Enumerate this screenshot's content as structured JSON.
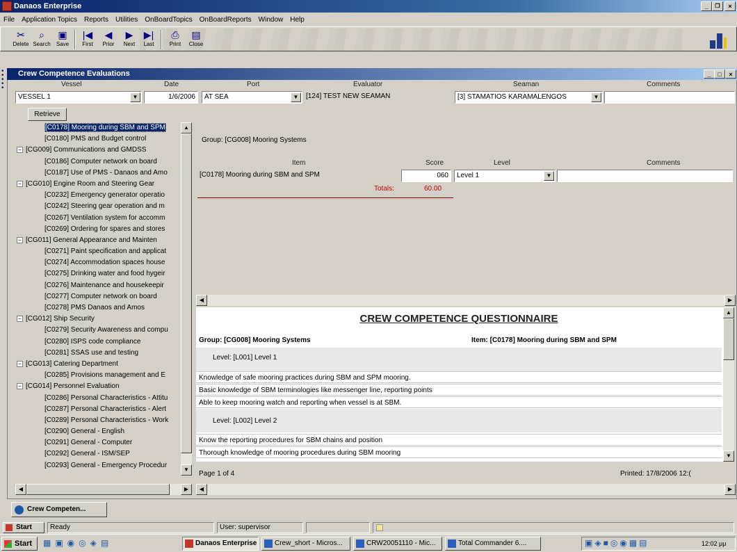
{
  "app": {
    "title": "Danaos Enterprise",
    "menu": [
      "File",
      "Application Topics",
      "Reports",
      "Utilities",
      "OnBoardTopics",
      "OnBoardReports",
      "Window",
      "Help"
    ],
    "window_controls": [
      "_",
      "ř",
      "×"
    ]
  },
  "toolbar": {
    "buttons": [
      {
        "label": "Delete",
        "icon": "delete-icon"
      },
      {
        "label": "Search",
        "icon": "search-icon"
      },
      {
        "label": "Save",
        "icon": "save-icon"
      },
      {
        "label": "First",
        "icon": "first-icon"
      },
      {
        "label": "Prior",
        "icon": "prior-icon"
      },
      {
        "label": "Next",
        "icon": "next-icon"
      },
      {
        "label": "Last",
        "icon": "last-icon"
      },
      {
        "label": "Print",
        "icon": "print-icon"
      },
      {
        "label": "Close",
        "icon": "close-icon"
      }
    ]
  },
  "child_window": {
    "title": "Crew Competence Evaluations",
    "controls": [
      "_",
      "□",
      "×"
    ]
  },
  "filters": {
    "headers": {
      "vessel": "Vessel",
      "date": "Date",
      "port": "Port",
      "evaluator": "Evaluator",
      "seaman": "Seaman",
      "comments": "Comments"
    },
    "vessel": "VESSEL 1",
    "date": "1/6/2006",
    "port": "AT SEA",
    "evaluator": "[124] TEST NEW SEAMAN",
    "seaman": "[3] STAMATIOS KARAMALENGOS",
    "comments": ""
  },
  "retrieve_label": "Retrieve",
  "tree": [
    {
      "kind": "item",
      "text": "[C0178] Mooring during SBM and SPM",
      "selected": true
    },
    {
      "kind": "item",
      "text": "[C0180] PMS and Budget control"
    },
    {
      "kind": "group",
      "text": "[CG009] Communications and GMDSS"
    },
    {
      "kind": "item",
      "text": "[C0186] Computer network on board"
    },
    {
      "kind": "item",
      "text": "[C0187] Use of PMS - Danaos and Amo"
    },
    {
      "kind": "group",
      "text": "[CG010] Engine Room and Steering Gear"
    },
    {
      "kind": "item",
      "text": "[C0232] Emergency generator operatio"
    },
    {
      "kind": "item",
      "text": "[C0242] Steering gear operation and m"
    },
    {
      "kind": "item",
      "text": "[C0267] Ventilation system for accomm"
    },
    {
      "kind": "item",
      "text": "[C0269] Ordering for spares and stores"
    },
    {
      "kind": "group",
      "text": "[CG011] General Appearance and Mainten"
    },
    {
      "kind": "item",
      "text": "[C0271] Paint specification and applicat"
    },
    {
      "kind": "item",
      "text": "[C0274] Accommodation spaces house"
    },
    {
      "kind": "item",
      "text": "[C0275] Drinking water and food hygeir"
    },
    {
      "kind": "item",
      "text": "[C0276] Maintenance and housekeepir"
    },
    {
      "kind": "item",
      "text": "[C0277] Computer network on board"
    },
    {
      "kind": "item",
      "text": "[C0278] PMS Danaos and Amos"
    },
    {
      "kind": "group",
      "text": "[CG012] Ship Security"
    },
    {
      "kind": "item",
      "text": "[C0279] Security Awareness and compu"
    },
    {
      "kind": "item",
      "text": "[C0280] ISPS code compliance"
    },
    {
      "kind": "item",
      "text": "[C0281] SSAS use and testing"
    },
    {
      "kind": "group",
      "text": "[CG013] Catering Department"
    },
    {
      "kind": "item",
      "text": "[C0285] Provisions management and E"
    },
    {
      "kind": "group",
      "text": "[CG014] Personnel Evaluation"
    },
    {
      "kind": "item",
      "text": "[C0286] Personal Characteristics - Attitu"
    },
    {
      "kind": "item",
      "text": "[C0287] Personal Characteristics - Alert"
    },
    {
      "kind": "item",
      "text": "[C0289] Personal Characteristics - Work"
    },
    {
      "kind": "item",
      "text": "[C0290] General - English"
    },
    {
      "kind": "item",
      "text": "[C0291] General - Computer"
    },
    {
      "kind": "item",
      "text": "[C0292] General - ISM/SEP"
    },
    {
      "kind": "item",
      "text": "[C0293] General - Emergency Procedur"
    }
  ],
  "detail": {
    "group_label": "Group: [CG008] Mooring Systems",
    "headers": {
      "item": "Item",
      "score": "Score",
      "level": "Level",
      "comments": "Comments"
    },
    "row": {
      "item": "[C0178] Mooring during SBM and SPM",
      "score": "060",
      "level": "Level 1",
      "comments": ""
    },
    "totals_label": "Totals:",
    "totals_value": "60.00"
  },
  "questionnaire": {
    "title": "CREW COMPETENCE QUESTIONNAIRE",
    "group": "Group: [CG008] Mooring Systems",
    "item": "Item: [C0178] Mooring during SBM and SPM",
    "level1": "Level: [L001] Level 1",
    "level1_lines": [
      "Knowledge of safe mooring practices during SBM and SPM mooring.",
      "Basic knowledge of SBM terminologies like messenger line, reporting points",
      "Able to keep mooring watch and reporting when vessel is at SBM."
    ],
    "level2": "Level: [L002] Level 2",
    "level2_lines": [
      "Know the reporting procedures for SBM chains and position",
      "Thorough knowledge of mooring procedures during SBM mooring"
    ],
    "page": "Page 1 of 4",
    "printed": "Printed: 17/8/2006 12:("
  },
  "mdi_tab": "Crew Competen...",
  "status": {
    "start": "Start",
    "ready": "Ready",
    "user": "User: supervisor"
  },
  "taskbar": {
    "start": "Start",
    "tasks": [
      "Danaos Enterprise",
      "Crew_short - Micros...",
      "CRW20051110 - Mic...",
      "Total Commander 6...."
    ],
    "clock": "12:02 μμ"
  },
  "colors": {
    "title_active": "#0a246a",
    "selection": "#0a246a",
    "totals_red": "#c00000",
    "face": "#d4d0c8"
  }
}
